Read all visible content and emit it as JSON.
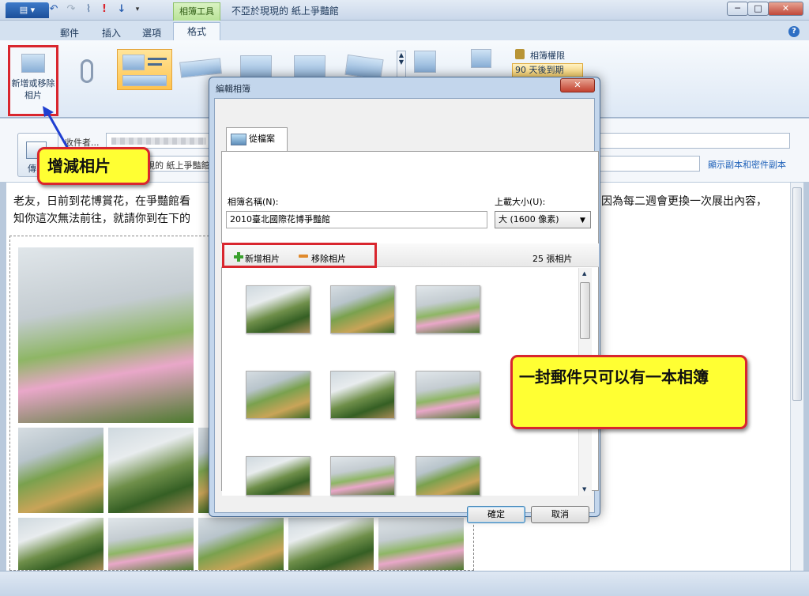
{
  "window": {
    "context_tab": "相簿工具",
    "title": "不亞於現現的 紙上爭豔館",
    "min": "─",
    "max": "□",
    "close": "✕"
  },
  "ribbon": {
    "file_label": "▤ ▾",
    "tabs": [
      "郵件",
      "插入",
      "選項",
      "格式"
    ],
    "add_remove_photos": "新增或移除相片",
    "album_permission": "相簿權限",
    "expiry": "90 天後到期",
    "help": "?"
  },
  "header": {
    "to_label": "收件者...",
    "send_label": "傳",
    "cc_link": "顯示副本和密件副本",
    "subject_fragment": "現的 紙上爭豔館"
  },
  "body": {
    "text_line1": "老友，日前到花博賞花，在爭豔館看",
    "text_line1_end": "因為每二週會更換一次展出內容，",
    "text_line2": "知你這次無法前往，就請你到在下的"
  },
  "dialog": {
    "title": "編輯相簿",
    "close": "✕",
    "tab_label": "從檔案",
    "album_name_label": "相簿名稱(N):",
    "album_name_value": "2010臺北國際花博爭豔館",
    "size_label": "上載大小(U):",
    "size_value": "大 (1600 像素)",
    "add_photos": "新增相片",
    "remove_photos": "移除相片",
    "photo_count": "25 張相片",
    "ok": "確定",
    "cancel": "取消"
  },
  "callouts": {
    "add_remove": "增減相片",
    "one_album": "一封郵件只可以有一本相簿"
  },
  "colors": {
    "accent_red": "#d9262e",
    "callout_yellow": "#ffff33",
    "ribbon_blue": "#1b4f9a"
  }
}
